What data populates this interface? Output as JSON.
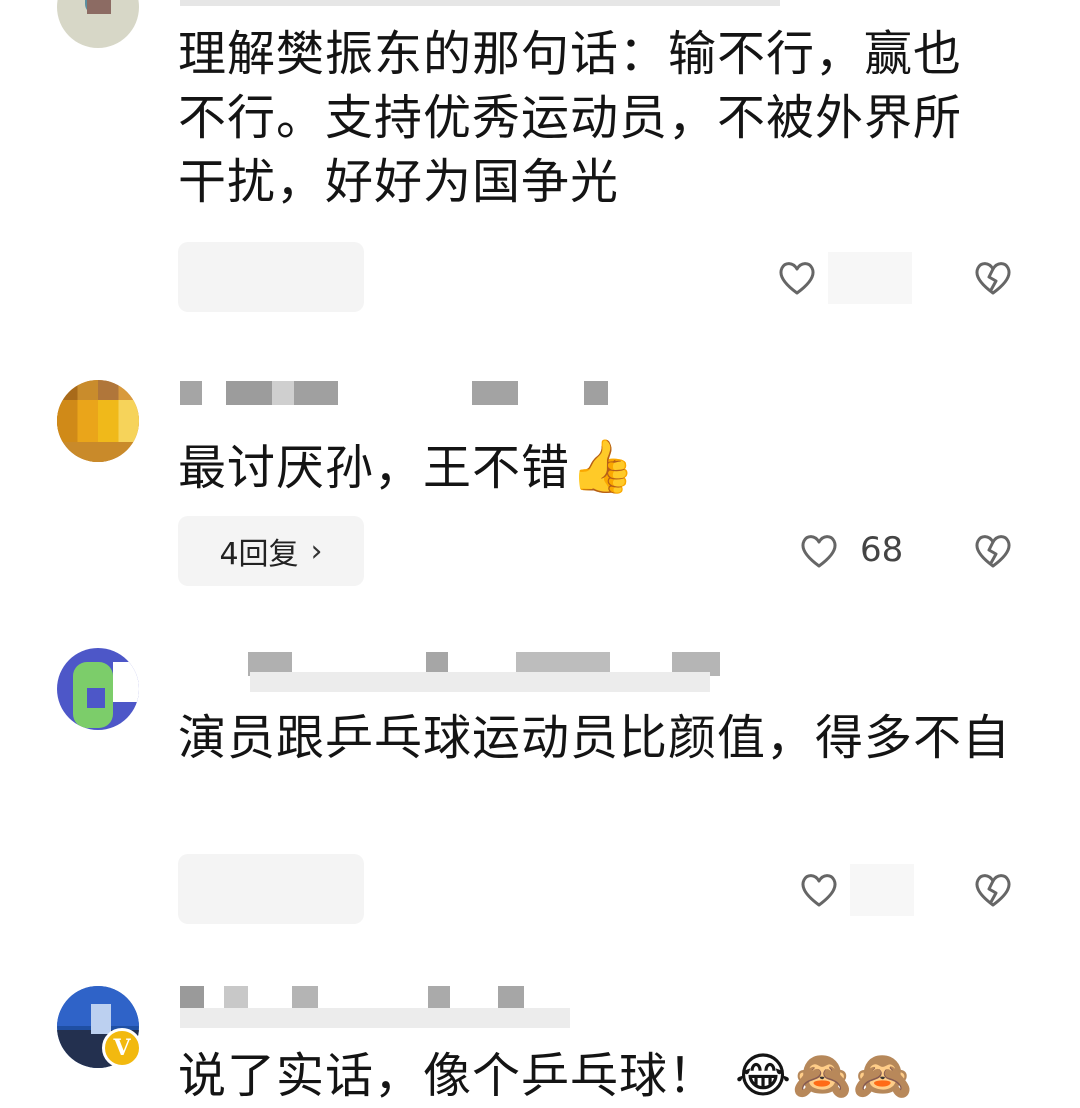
{
  "comments": [
    {
      "text": "理解樊振东的那句话：输不行，赢也不行。支持优秀运动员，不被外界所干扰，好好为国争光",
      "reply_label": "",
      "likes": ""
    },
    {
      "text": "最讨厌孙，王不错",
      "emoji": "👍",
      "reply_label": "4回复",
      "likes": "68"
    },
    {
      "text": "演员跟乒乓球运动员比颜值，得多不自",
      "reply_label": "",
      "likes": ""
    },
    {
      "text": "说了实话，像个乒乓球！",
      "emoji": "😂🙈🙈"
    }
  ],
  "icons": {
    "like": "heart-outline-icon",
    "dislike": "broken-heart-icon",
    "reply_chevron": "chevron-right-icon",
    "verified": "v-badge-icon"
  },
  "colors": {
    "text": "#141414",
    "icon_gray": "#666666",
    "pill_bg": "#f4f4f4",
    "badge": "#f2b90f"
  }
}
